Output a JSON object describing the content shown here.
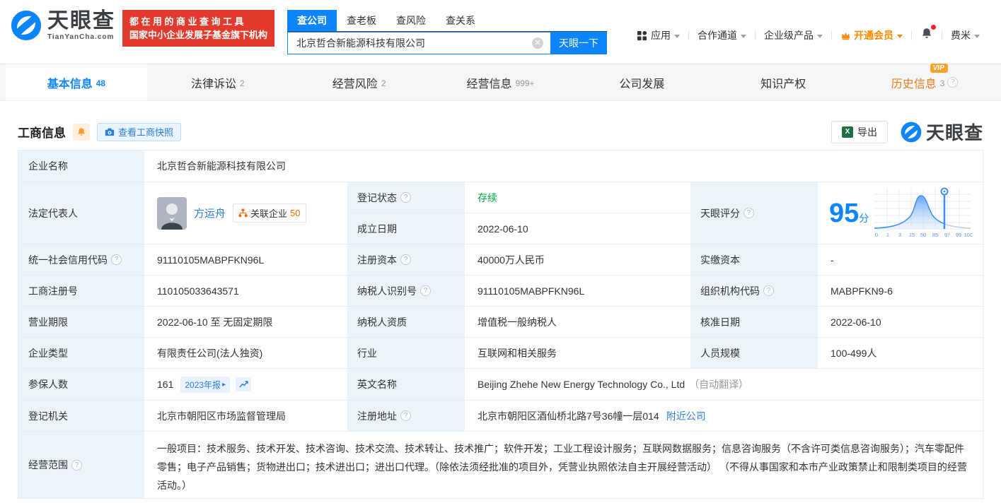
{
  "brand": {
    "name": "天眼查",
    "domain": "TianYanCha.com",
    "accent": "#0d85ff"
  },
  "banner": {
    "line1": "都在用的商业查询工具",
    "line2": "国家中小企业发展子基金旗下机构",
    "bg": "#e23b2e"
  },
  "search": {
    "tabs": [
      "查公司",
      "查老板",
      "查风险",
      "查关系"
    ],
    "active_tab": "查公司",
    "value": "北京哲合新能源科技有限公司",
    "submit": "天眼一下"
  },
  "usernav": {
    "apps": "应用",
    "partner": "合作通道",
    "enterprise": "企业级产品",
    "vip": "开通会员",
    "user": "费米"
  },
  "tabs": [
    {
      "label": "基本信息",
      "count": "48"
    },
    {
      "label": "法律诉讼",
      "count": "2"
    },
    {
      "label": "经营风险",
      "count": "2"
    },
    {
      "label": "经营信息",
      "count": "999+"
    },
    {
      "label": "公司发展"
    },
    {
      "label": "知识产权"
    },
    {
      "label": "历史信息",
      "count": "3",
      "vip_badge": "VIP"
    }
  ],
  "toolbar": {
    "title": "工商信息",
    "snapshot": "查看工商快照",
    "export": "导出",
    "watermark": "天眼查"
  },
  "score": {
    "label": "天眼评分",
    "value": "95",
    "unit": "分",
    "axis": [
      "0",
      "1",
      "3",
      "15",
      "50",
      "85",
      "97",
      "99",
      "100"
    ],
    "marker_percent": 73
  },
  "fields": {
    "company_name": {
      "label": "企业名称",
      "value": "北京哲合新能源科技有限公司"
    },
    "legal_rep": {
      "label": "法定代表人",
      "name": "方运舟",
      "rel_label": "关联企业",
      "rel_count": "50"
    },
    "reg_status": {
      "label": "登记状态",
      "value": "存续"
    },
    "establish_date": {
      "label": "成立日期",
      "value": "2022-06-10"
    },
    "credit_code": {
      "label": "统一社会信用代码",
      "value": "91110105MABPFKN96L"
    },
    "reg_capital": {
      "label": "注册资本",
      "value": "40000万人民币"
    },
    "paid_capital": {
      "label": "实缴资本",
      "value": "-"
    },
    "reg_number": {
      "label": "工商注册号",
      "value": "110105033643571"
    },
    "taxpayer_id": {
      "label": "纳税人识别号",
      "value": "91110105MABPFKN96L"
    },
    "org_code": {
      "label": "组织机构代码",
      "value": "MABPFKN9-6"
    },
    "business_term": {
      "label": "营业期限",
      "value": "2022-06-10 至 无固定期限"
    },
    "taxpayer_quality": {
      "label": "纳税人资质",
      "value": "增值税一般纳税人"
    },
    "approval_date": {
      "label": "核准日期",
      "value": "2022-06-10"
    },
    "company_type": {
      "label": "企业类型",
      "value": "有限责任公司(法人独资)"
    },
    "industry": {
      "label": "行业",
      "value": "互联网和相关服务"
    },
    "staff_size": {
      "label": "人员规模",
      "value": "100-499人"
    },
    "insured_count": {
      "label": "参保人数",
      "value": "161",
      "report_badge": "2023年报"
    },
    "english_name": {
      "label": "英文名称",
      "value": "Beijing Zhehe New Energy Technology Co., Ltd",
      "note": "（自动翻译）"
    },
    "reg_authority": {
      "label": "登记机关",
      "value": "北京市朝阳区市场监督管理局"
    },
    "reg_address": {
      "label": "注册地址",
      "value": "北京市朝阳区酒仙桥北路7号36幢一层014",
      "nearby": "附近公司"
    },
    "business_scope": {
      "label": "经营范围",
      "value": "一般项目：技术服务、技术开发、技术咨询、技术交流、技术转让、技术推广；软件开发；工业工程设计服务；互联网数据服务；信息咨询服务（不含许可类信息咨询服务）；汽车零配件零售；电子产品销售；货物进出口；技术进出口；进出口代理。（除依法须经批准的项目外，凭营业执照依法自主开展经营活动） （不得从事国家和本市产业政策禁止和限制类项目的经营活动。）"
    }
  }
}
